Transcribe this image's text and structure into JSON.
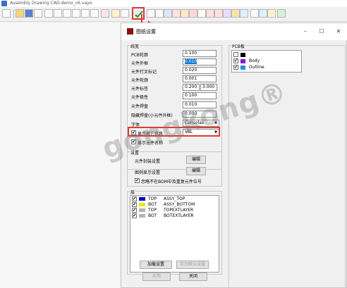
{
  "app": {
    "title": "Assembly Drawing CAD:demo_v6.vayo"
  },
  "dialog": {
    "title": "图纸设置",
    "min": "–",
    "max": "☐",
    "close": "✕"
  },
  "lines": {
    "group_label": "线宽",
    "rows": [
      {
        "label": "PCB轮廓",
        "value": "0.100"
      },
      {
        "label": "元件外框",
        "value": "0.010"
      },
      {
        "label": "元件打叉标记",
        "value": "0.020"
      },
      {
        "label": "元件轮廓",
        "value": "0.001"
      },
      {
        "label": "元件标签",
        "value": "0.200",
        "value2": "3.000"
      },
      {
        "label": "元件极性",
        "value": "0.100"
      },
      {
        "label": "元件焊盘",
        "value": "0.010"
      },
      {
        "label": "隐藏焊盘(小元件外框)",
        "value": "0.000"
      }
    ],
    "font_label": "字体",
    "font_value": "Consolas",
    "show_other_info_label": "显示其它信息",
    "show_other_info_value": "VAL",
    "show_ref_label": "显示元件名称"
  },
  "settings": {
    "group_label": "设置",
    "pkg_label": "元件封装设置",
    "pkg_btn": "编辑",
    "legend_label": "图例显示设置",
    "legend_btn": "编辑",
    "ignore_bom_label": "忽略不在BOM中及重复元件位号"
  },
  "layers": {
    "group_label": "层",
    "rows": [
      {
        "side": "TOP",
        "name": "ASSY_TOP",
        "color": "#0000c8"
      },
      {
        "side": "BOT",
        "name": "ASSY_BOTTOM",
        "color": "#f5e600"
      },
      {
        "side": "TOP",
        "name": "TOPEXTLAYER",
        "color": "#b4b4b4"
      },
      {
        "side": "BOT",
        "name": "BOTEXTLAYER",
        "color": "#b4b4b4"
      }
    ]
  },
  "pcb_panel": {
    "group_label": "PCB板",
    "rows": [
      {
        "name": "",
        "checked": false,
        "color": "#000000"
      },
      {
        "name": "Body",
        "checked": true,
        "color": "#7a1fd1"
      },
      {
        "name": "Outline",
        "checked": true,
        "color": "#1f8fe0"
      }
    ]
  },
  "footer": {
    "load_btn": "加载设置",
    "save_default_btn": "存为默认设置",
    "apply_btn": "应用",
    "close_btn": "关闭"
  },
  "watermark": "gongkong®",
  "colors": {
    "highlight": "#e23b2e",
    "selection": "#0078d7"
  }
}
